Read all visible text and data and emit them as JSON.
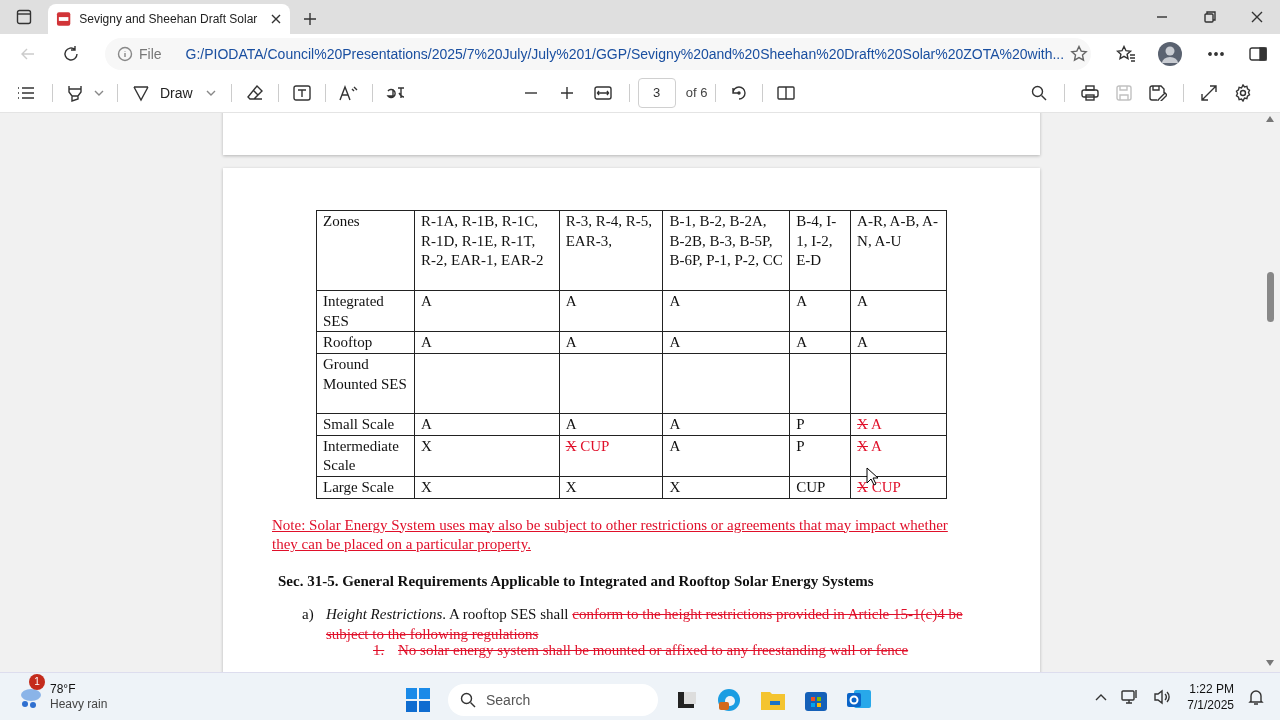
{
  "browser": {
    "tab_title": "Sevigny and Sheehan Draft Solar",
    "address_scheme": "File",
    "url": "G:/PIODATA/Council%20Presentations/2025/7%20July/July%201/GGP/Sevigny%20and%20Sheehan%20Draft%20Solar%20ZOTA%20with..."
  },
  "pdf_toolbar": {
    "draw_label": "Draw",
    "page": "3",
    "page_count": "of 6"
  },
  "document": {
    "table": {
      "columns": [
        "Zones",
        "R-1A, R-1B, R-1C, R-1D, R-1E, R-1T, R-2, EAR-1, EAR-2",
        "R-3, R-4, R-5, EAR-3,",
        "B-1, B-2, B-2A, B-2B, B-3, B-5P, B-6P, P-1, P-2, CC",
        "B-4, I-1, I-2, E-D",
        "A-R, A-B, A-N, A-U"
      ],
      "rows": [
        {
          "label": "Integrated SES",
          "cells": [
            "A",
            "A",
            "A",
            "A",
            "A"
          ]
        },
        {
          "label": "Rooftop",
          "cells": [
            "A",
            "A",
            "A",
            "A",
            "A"
          ]
        },
        {
          "label": "Ground Mounted SES"
        },
        {
          "label": "Small Scale",
          "cells": [
            "A",
            "A",
            "A",
            "P",
            {
              "deleted": "X",
              "inserted": "A"
            }
          ]
        },
        {
          "label": "Intermediate Scale",
          "cells": [
            "X",
            {
              "deleted": "X",
              "inserted": "CUP"
            },
            "A",
            "P",
            {
              "deleted": "X",
              "inserted": "A"
            }
          ]
        },
        {
          "label": "Large Scale",
          "cells": [
            "X",
            "X",
            "X",
            "CUP",
            {
              "deleted": "X",
              "inserted": "CUP"
            }
          ]
        }
      ]
    },
    "note": "Note: Solar Energy System uses may also be subject to other restrictions or agreements that may impact whether they can be placed on a particular property.",
    "section_heading": "Sec. 31-5. General Requirements Applicable to Integrated and Rooftop Solar Energy Systems",
    "paragraph": {
      "marker": "a)",
      "parts": [
        {
          "kind": "italic",
          "text": "Height Restrictions"
        },
        {
          "kind": "plain",
          "text": ". A rooftop SES shall "
        },
        {
          "kind": "deleted",
          "text": "conform to the height restrictions provided in Article 15-1(c)4 be subject to the following regulations"
        }
      ]
    },
    "list_item": {
      "marker": "1.",
      "text": "No solar energy system shall be mounted or affixed to any freestanding wall or fence"
    }
  },
  "taskbar": {
    "weather_badge": "1",
    "temperature": "78°F",
    "condition": "Heavy rain",
    "search_placeholder": "Search",
    "time": "1:22 PM",
    "date": "7/1/2025"
  }
}
